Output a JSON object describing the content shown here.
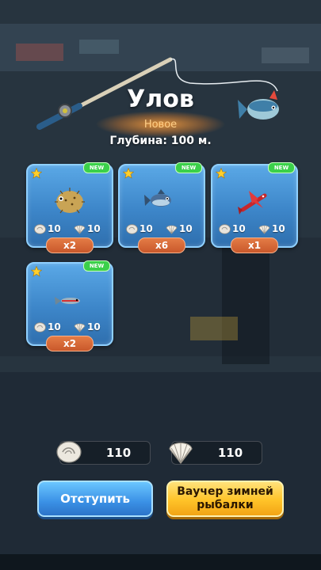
{
  "header": {
    "title": "Улов",
    "subtitle": "Новое",
    "depth": "Глубина: 100 м."
  },
  "catch_items": [
    {
      "fish_icon": "pufferfish-icon",
      "new_badge": "NEW",
      "stones": "10",
      "shells": "10",
      "count": "x2"
    },
    {
      "fish_icon": "blue-fish-icon",
      "new_badge": "NEW",
      "stones": "10",
      "shells": "10",
      "count": "x6"
    },
    {
      "fish_icon": "red-flying-fish-icon",
      "new_badge": "NEW",
      "stones": "10",
      "shells": "10",
      "count": "x1"
    },
    {
      "fish_icon": "small-striped-fish-icon",
      "new_badge": "NEW",
      "stones": "10",
      "shells": "10",
      "count": "x2"
    }
  ],
  "totals": {
    "stones": "110",
    "shells": "110"
  },
  "buttons": {
    "retreat": "Отступить",
    "voucher": "Ваучер зимней рыбалки"
  },
  "colors": {
    "card_blue": "#3d86c9",
    "new_badge_green": "#3bd04a",
    "count_orange": "#d9653a",
    "retreat_blue": "#3a90e5",
    "voucher_yellow": "#ffc328"
  }
}
